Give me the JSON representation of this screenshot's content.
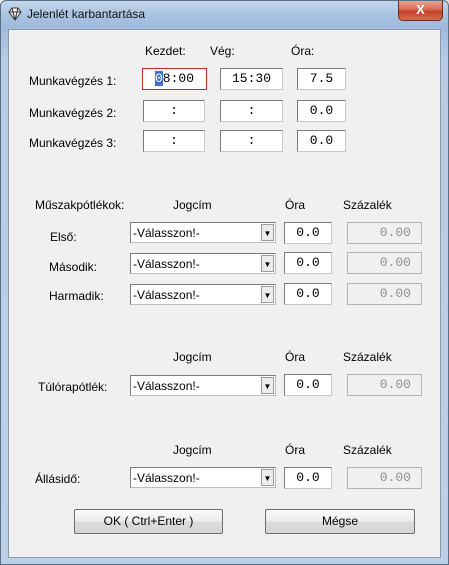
{
  "window": {
    "title": "Jelenlét karbantartása",
    "close_label": "X"
  },
  "work": {
    "headers": {
      "start": "Kezdet:",
      "end": "Vég:",
      "hours": "Óra:"
    },
    "rows": [
      {
        "label": "Munkavégzés 1:",
        "start_selected": "0",
        "start_rest": "8:00",
        "end": "15:30",
        "hours": "7.5"
      },
      {
        "label": "Munkavégzés 2:",
        "start": " : ",
        "end": " : ",
        "hours": "0.0"
      },
      {
        "label": "Munkavégzés 3:",
        "start": " : ",
        "end": " : ",
        "hours": "0.0"
      }
    ]
  },
  "shift": {
    "headers": {
      "title": "Műszakpótlékok:",
      "reason": "Jogcím",
      "hours": "Óra",
      "percent": "Százalék"
    },
    "rows": [
      {
        "label": "Első:",
        "reason": "-Válasszon!-",
        "hours": "0.0",
        "percent": "0.00"
      },
      {
        "label": "Második:",
        "reason": "-Válasszon!-",
        "hours": "0.0",
        "percent": "0.00"
      },
      {
        "label": "Harmadik:",
        "reason": "-Válasszon!-",
        "hours": "0.0",
        "percent": "0.00"
      }
    ]
  },
  "overtime": {
    "headers": {
      "reason": "Jogcím",
      "hours": "Óra",
      "percent": "Százalék"
    },
    "label": "Túlórapótlék:",
    "reason": "-Válasszon!-",
    "hours": "0.0",
    "percent": "0.00"
  },
  "standby": {
    "headers": {
      "reason": "Jogcím",
      "hours": "Óra",
      "percent": "Százalék"
    },
    "label": "Állásidő:",
    "reason": "-Válasszon!-",
    "hours": "0.0",
    "percent": "0.00"
  },
  "buttons": {
    "ok": "OK ( Ctrl+Enter )",
    "cancel": "Mégse"
  },
  "icons": {
    "app": "diamond-icon",
    "close": "close-icon",
    "dropdown": "chevron-down-icon"
  },
  "colors": {
    "title_bar": "#a9c4e1",
    "close_button": "#c4412a",
    "selection": "#3f6fd1",
    "active_border": "#cc2a2a"
  }
}
